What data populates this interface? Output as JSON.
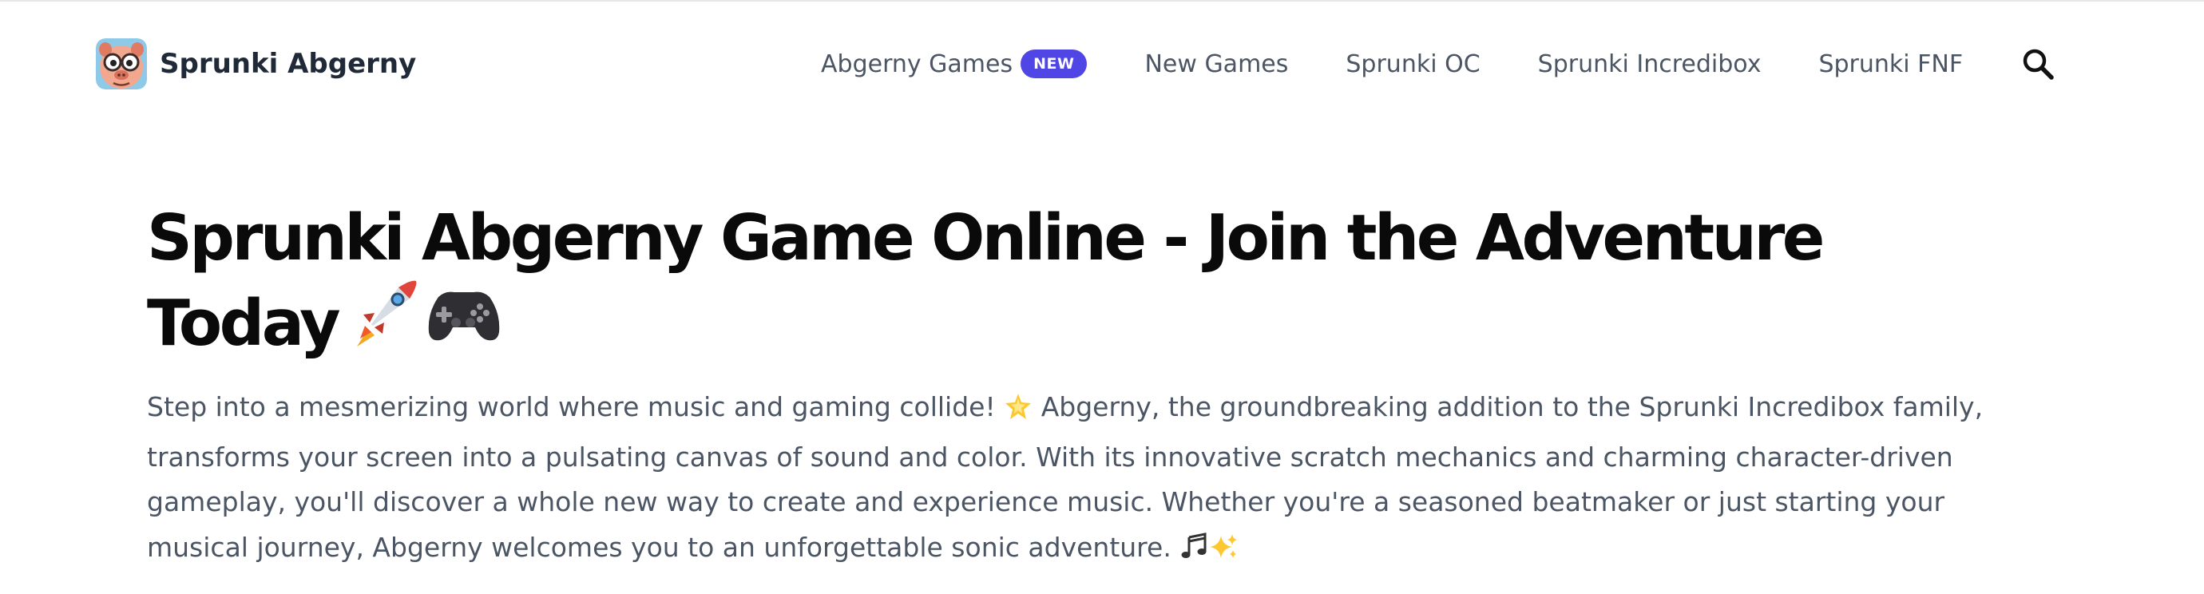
{
  "brand": {
    "name": "Sprunki Abgerny",
    "logo_icon": "cartoon-pig-face-icon"
  },
  "nav": {
    "items": [
      {
        "label": "Abgerny Games",
        "badge": "NEW"
      },
      {
        "label": "New Games"
      },
      {
        "label": "Sprunki OC"
      },
      {
        "label": "Sprunki Incredibox"
      },
      {
        "label": "Sprunki FNF"
      }
    ],
    "search_icon": "search-icon"
  },
  "hero": {
    "title_line1": "Sprunki Abgerny Game Online - Join the Adventure",
    "title_line2": "Today",
    "title_emojis": [
      "rocket-icon",
      "game-controller-icon"
    ],
    "desc_line1_a": "Step into a mesmerizing world where music and gaming collide!",
    "desc_line1_b": "Abgerny, the groundbreaking addition to the Sprunki Incredibox family,",
    "desc_line2": "transforms your screen into a pulsating canvas of sound and color. With its innovative scratch mechanics and charming character-driven",
    "desc_line3": "gameplay, you'll discover a whole new way to create and experience music. Whether you're a seasoned beatmaker or just starting your",
    "desc_line4": "musical journey, Abgerny welcomes you to an unforgettable sonic adventure.",
    "desc_emojis": [
      "glowing-star-icon",
      "music-notes-icon",
      "sparkles-icon"
    ]
  },
  "colors": {
    "badge": "#4f46e5",
    "title": "#0a0a0a",
    "text": "#4b5563",
    "brand_text": "#1f2937"
  }
}
